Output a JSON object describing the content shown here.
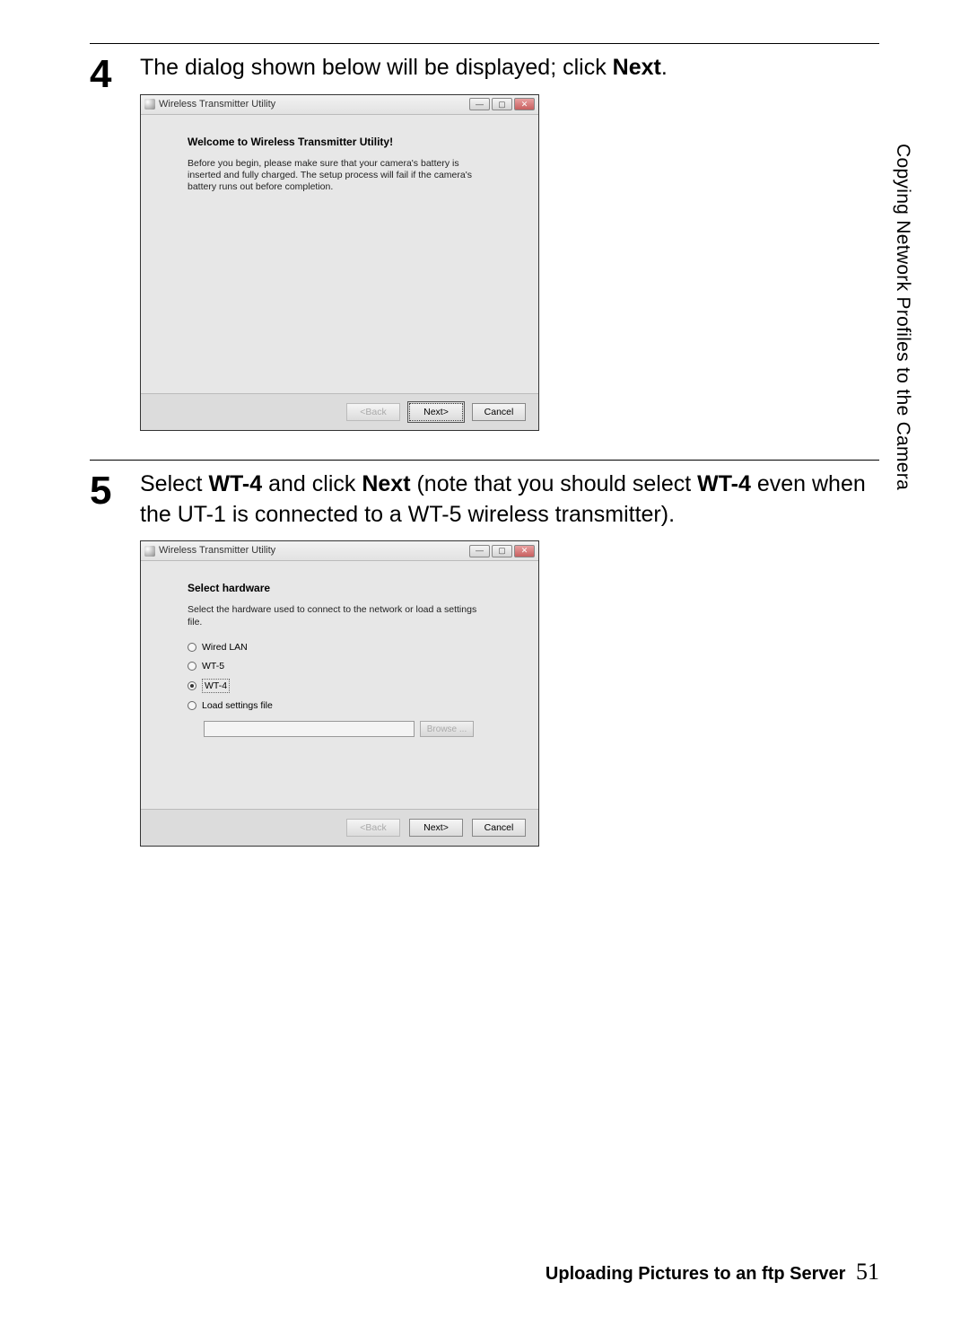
{
  "side_label": "Copying Network Profiles to the Camera",
  "step4": {
    "num": "4",
    "text_pre": "The dialog shown below will be displayed; click ",
    "text_bold": "Next",
    "text_post": "."
  },
  "step5": {
    "num": "5",
    "text1_pre": "Select ",
    "text1_b1": "WT-4",
    "text1_mid": " and click ",
    "text1_b2": "Next",
    "text1_post1": " (note that you should select ",
    "text1_b3": "WT-4",
    "text2": " even when the UT-1 is connected to a WT-5 wireless transmitter)."
  },
  "dialog_common": {
    "title": "Wireless Transmitter Utility",
    "back": "<Back",
    "next": "Next>",
    "cancel": "Cancel"
  },
  "dialog1": {
    "heading": "Welcome to Wireless Transmitter Utility!",
    "desc": "Before you begin, please make sure that your camera's battery is inserted and fully charged. The setup process will fail if the camera's battery runs out before completion."
  },
  "dialog2": {
    "heading": "Select hardware",
    "desc": "Select the hardware used to connect to the network or load a settings file.",
    "opt_wired": "Wired LAN",
    "opt_wt5": "WT-5",
    "opt_wt4": "WT-4",
    "opt_load": "Load settings file",
    "browse": "Browse ..."
  },
  "footer": {
    "text": "Uploading Pictures to an ftp Server",
    "page": "51"
  }
}
